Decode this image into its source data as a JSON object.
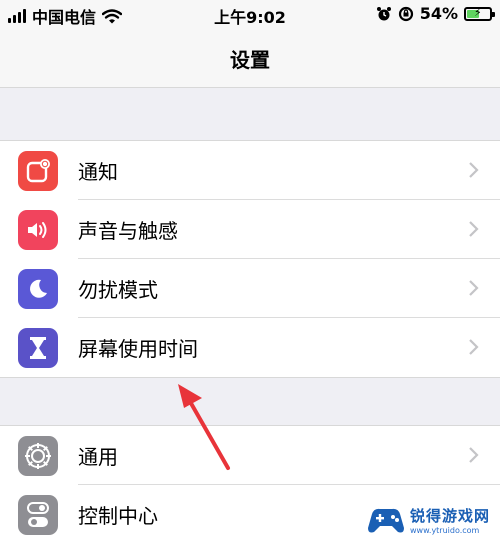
{
  "status": {
    "carrier": "中国电信",
    "time": "上午9:02",
    "battery_pct": "54%",
    "battery_level": 0.54,
    "battery_color": "#5fd35f"
  },
  "nav": {
    "title": "设置"
  },
  "groups": [
    {
      "items": [
        {
          "label": "通知",
          "icon": "notifications-icon",
          "color": "#f04a44"
        },
        {
          "label": "声音与触感",
          "icon": "sound-icon",
          "color": "#f1445d"
        },
        {
          "label": "勿扰模式",
          "icon": "moon-icon",
          "color": "#5a58d6"
        },
        {
          "label": "屏幕使用时间",
          "icon": "hourglass-icon",
          "color": "#5a52c8"
        }
      ]
    },
    {
      "items": [
        {
          "label": "通用",
          "icon": "gear-icon",
          "color": "#8e8e93"
        },
        {
          "label": "控制中心",
          "icon": "toggles-icon",
          "color": "#8e8e93"
        }
      ]
    }
  ],
  "annotation": {
    "color": "#e8343a"
  },
  "watermark": {
    "text": "锐得游戏网",
    "url": "www.ytruido.com"
  }
}
